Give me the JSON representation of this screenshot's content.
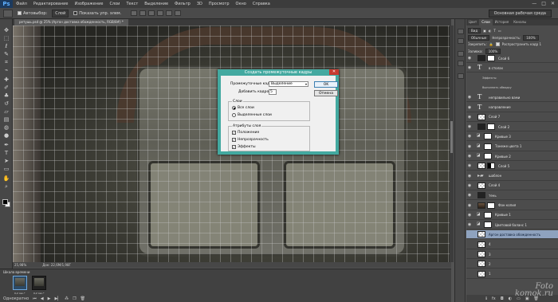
{
  "app": {
    "logo": "Ps"
  },
  "menu": [
    "Файл",
    "Редактирование",
    "Изображение",
    "Слои",
    "Текст",
    "Выделение",
    "Фильтр",
    "3D",
    "Просмотр",
    "Окно",
    "Справка"
  ],
  "window_controls": {
    "minimize": "—",
    "maximize": "□",
    "close": "✕"
  },
  "options": {
    "autoselect": "Автовыбор:",
    "layer_select": "Слой",
    "show_controls": "Показать упр. элем.",
    "workspace": "Основная рабочая среда"
  },
  "document": {
    "tab": "ретушь.psd @ 25% (Аргон доставка обожденность, RGB/8#) *"
  },
  "status": {
    "zoom": "25,98%",
    "doc": "Док: 22,6M/1,98Г"
  },
  "timeline": {
    "title": "Шкала времени",
    "frames": [
      {
        "time": "0,2 сек.*",
        "selected": true
      },
      {
        "time": "0,2 сек.*",
        "selected": false
      }
    ],
    "loop": "Однократно"
  },
  "dialog": {
    "title": "Создать промежуточные кадры",
    "tween_label": "Промежуточные кадры:",
    "tween_value": "Выделение",
    "frames_label": "Добавить кадров:",
    "frames_value": "5",
    "ok": "OK",
    "cancel": "Отмена",
    "layers_group": "Слои",
    "all_layers": "Все слои",
    "selected_layers": "Выделенные слои",
    "params_group": "Атрибуты слоя",
    "position": "Положение",
    "opacity": "Непрозрачность",
    "effects": "Эффекты"
  },
  "panel": {
    "tabs": [
      "Цвет",
      "Слои",
      "История",
      "Каналы"
    ],
    "active_tab": "Слои",
    "kind": "Вид",
    "blend": "Обычные",
    "opacity_label": "Непрозрачность:",
    "opacity_value": "100%",
    "lock_label": "Закрепить:",
    "propagate": "Распространить кадр 1",
    "fill_label": "Заливка:",
    "fill_value": "100%"
  },
  "layers": [
    {
      "name": "Слой 6",
      "thumb": "mask",
      "eye": true
    },
    {
      "name": "в столах",
      "thumb": "text",
      "eye": true
    },
    {
      "name": "Эффекты",
      "thumb": "sub",
      "eye": false
    },
    {
      "name": "Выполнить обводку",
      "thumb": "sub",
      "eye": false
    },
    {
      "name": "неправильно вами",
      "thumb": "text",
      "eye": true
    },
    {
      "name": "направление",
      "thumb": "text",
      "eye": true
    },
    {
      "name": "Слой 7",
      "thumb": "plain",
      "eye": true
    },
    {
      "name": "Слой 2",
      "thumb": "mask",
      "eye": true
    },
    {
      "name": "Кривые 3",
      "thumb": "curves",
      "eye": true
    },
    {
      "name": "Тонеже цвета 1",
      "thumb": "curves",
      "eye": true
    },
    {
      "name": "Кривые 2",
      "thumb": "curves",
      "eye": true
    },
    {
      "name": "Слой 5",
      "thumb": "halfmask",
      "eye": true
    },
    {
      "name": "шаблон",
      "thumb": "folder",
      "eye": true
    },
    {
      "name": "Слой 4",
      "thumb": "plain",
      "eye": true
    },
    {
      "name": "тень",
      "thumb": "dark",
      "eye": true
    },
    {
      "name": "Фон копия",
      "thumb": "img",
      "eye": true
    },
    {
      "name": "Кривые 1",
      "thumb": "curves",
      "eye": true
    },
    {
      "name": "Цветовой баланс 1",
      "thumb": "curves",
      "eye": true
    },
    {
      "name": "Аргон доставка обожденность",
      "thumb": "plain",
      "eye": false,
      "selected": true
    },
    {
      "name": "4",
      "thumb": "plain",
      "eye": false
    },
    {
      "name": "3",
      "thumb": "plain",
      "eye": false
    },
    {
      "name": "2",
      "thumb": "plain",
      "eye": false
    },
    {
      "name": "1",
      "thumb": "plain",
      "eye": false
    }
  ],
  "panel_footer": [
    "ℹ",
    "fx",
    "◘",
    "◐",
    "▭",
    "▣",
    "🗑"
  ],
  "watermark": {
    "line1": "Foto",
    "line2": "komok.ru"
  }
}
